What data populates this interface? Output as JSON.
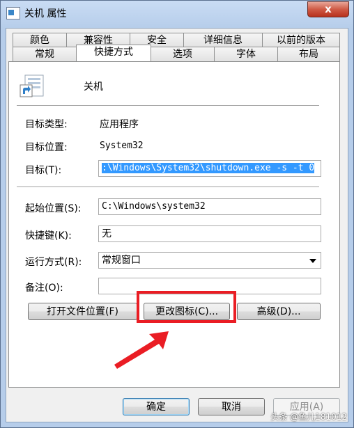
{
  "window": {
    "title": "关机 属性",
    "close_glyph": "x"
  },
  "tabs_row1": [
    "颜色",
    "兼容性",
    "安全",
    "详细信息",
    "以前的版本"
  ],
  "tabs_row2": [
    "常规",
    "快捷方式",
    "选项",
    "字体",
    "布局"
  ],
  "shortcut": {
    "name": "关机",
    "target_type_label": "目标类型:",
    "target_type_value": "应用程序",
    "target_location_label": "目标位置:",
    "target_location_value": "System32",
    "target_label": "目标(T):",
    "target_value": ":\\Windows\\System32\\shutdown.exe -s -t 0",
    "start_in_label": "起始位置(S):",
    "start_in_value": "C:\\Windows\\system32",
    "shortcut_key_label": "快捷键(K):",
    "shortcut_key_value": "无",
    "run_label": "运行方式(R):",
    "run_value": "常规窗口",
    "comment_label": "备注(O):",
    "comment_value": ""
  },
  "buttons": {
    "open_location": "打开文件位置(F)",
    "change_icon": "更改图标(C)...",
    "advanced": "高级(D)...",
    "ok": "确定",
    "cancel": "取消",
    "apply": "应用(A)"
  },
  "watermark": "头条 @鱼儿181012",
  "colors": {
    "highlight": "#3399ff",
    "annotation": "#ea1d24"
  }
}
